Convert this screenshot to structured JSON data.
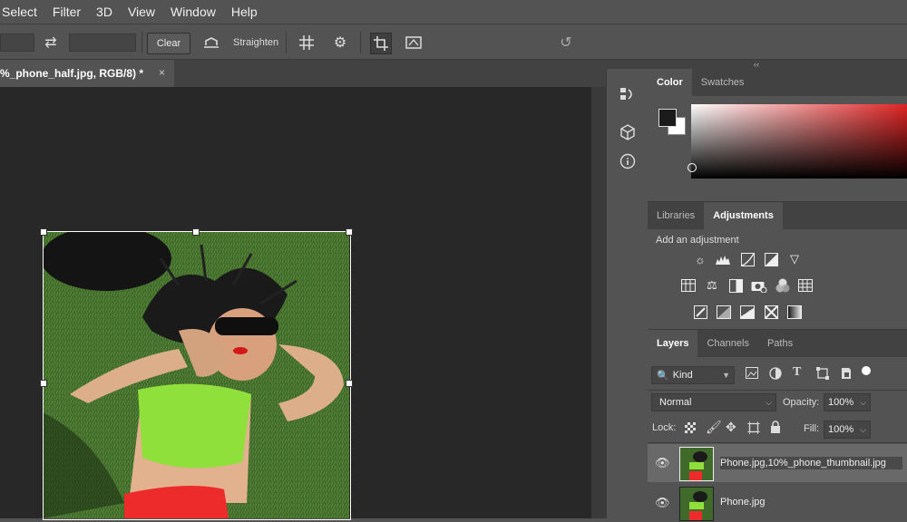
{
  "menu": [
    "Select",
    "Filter",
    "3D",
    "View",
    "Window",
    "Help"
  ],
  "options_bar": {
    "clear_label": "Clear",
    "straighten_label": "Straighten",
    "icons": [
      "swap-icon",
      "straighten-icon",
      "grid-overlay-icon",
      "gear-icon",
      "delete-cropped-pixels-icon",
      "content-aware-icon",
      "reset-icon"
    ]
  },
  "document": {
    "tab_title": "%_phone_half.jpg, RGB/8) *",
    "close_label": "×"
  },
  "collapse_label": "‹‹",
  "color_panel": {
    "tabs": [
      "Color",
      "Swatches"
    ],
    "active_tab": "Color",
    "foreground_color": "#1b1b1b",
    "background_color": "#ffffff",
    "hue_color": "#e12424"
  },
  "adjustments_panel": {
    "tabs": [
      "Libraries",
      "Adjustments"
    ],
    "active_tab": "Adjustments",
    "heading": "Add an adjustment",
    "rows": [
      [
        "brightness-contrast-icon",
        "levels-icon",
        "curves-icon",
        "exposure-icon",
        "vibrance-icon"
      ],
      [
        "hue-saturation-icon",
        "color-balance-icon",
        "black-white-icon",
        "photo-filter-icon",
        "channel-mixer-icon",
        "color-lookup-icon"
      ],
      [
        "invert-icon",
        "posterize-icon",
        "threshold-icon",
        "selective-color-icon",
        "gradient-map-icon"
      ]
    ]
  },
  "layers_panel": {
    "tabs": [
      "Layers",
      "Channels",
      "Paths"
    ],
    "active_tab": "Layers",
    "filter_label": "Kind",
    "blend_mode": "Normal",
    "opacity_label": "Opacity:",
    "opacity_value": "100%",
    "lock_label": "Lock:",
    "fill_label": "Fill:",
    "fill_value": "100%",
    "layers": [
      {
        "name": "Phone.jpg,10%_phone_thumbnail.jpg",
        "selected": true
      },
      {
        "name": "Phone.jpg",
        "selected": false
      }
    ]
  }
}
